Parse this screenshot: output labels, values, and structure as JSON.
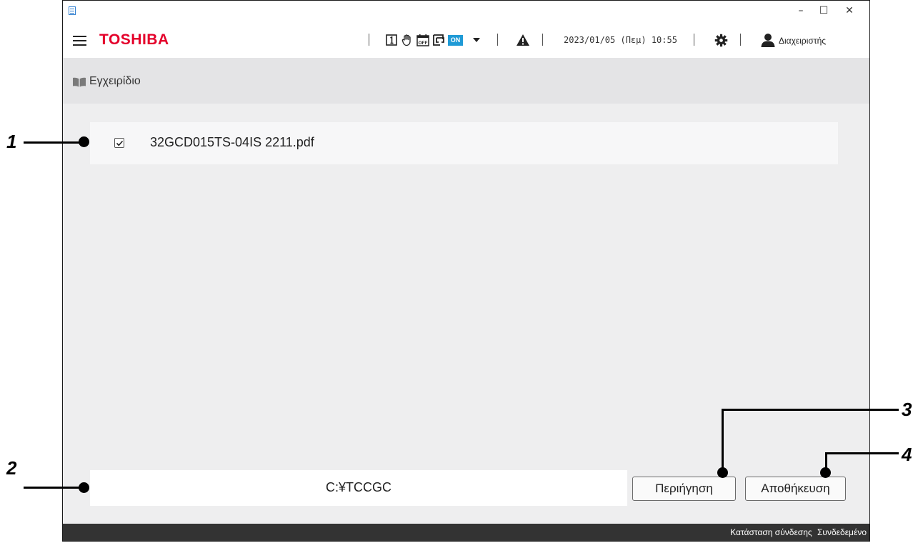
{
  "window": {
    "minimize": "–",
    "maximize": "☐",
    "close": "✕"
  },
  "header": {
    "brand": "TOSHIBA",
    "icons": [
      "number-one-icon",
      "hand-stop-icon",
      "calendar-off-icon",
      "switch-icon",
      "on-badge",
      "dropdown-arrow-icon",
      "warning-icon",
      "settings-gear-icon",
      "user-icon"
    ],
    "on_badge": "ON",
    "datetime": "2023/01/05 (Πεμ) 10:55",
    "user": "Διαχειριστής"
  },
  "breadcrumb": {
    "label": "Εγχειρίδιο"
  },
  "files": [
    {
      "name": "32GCD015TS-04IS 2211.pdf",
      "checked": true
    }
  ],
  "path": {
    "value": "C:¥TCCGC"
  },
  "buttons": {
    "browse": "Περιήγηση",
    "save": "Αποθήκευση"
  },
  "status": {
    "label": "Κατάσταση σύνδεσης",
    "value": "Συνδεδεμένο"
  },
  "callouts": [
    "1",
    "2",
    "3",
    "4"
  ],
  "colors": {
    "brand": "#e4002b",
    "on_badge": "#1f9ad6",
    "statusbar": "#333333",
    "content_bg": "#eeeeef"
  }
}
